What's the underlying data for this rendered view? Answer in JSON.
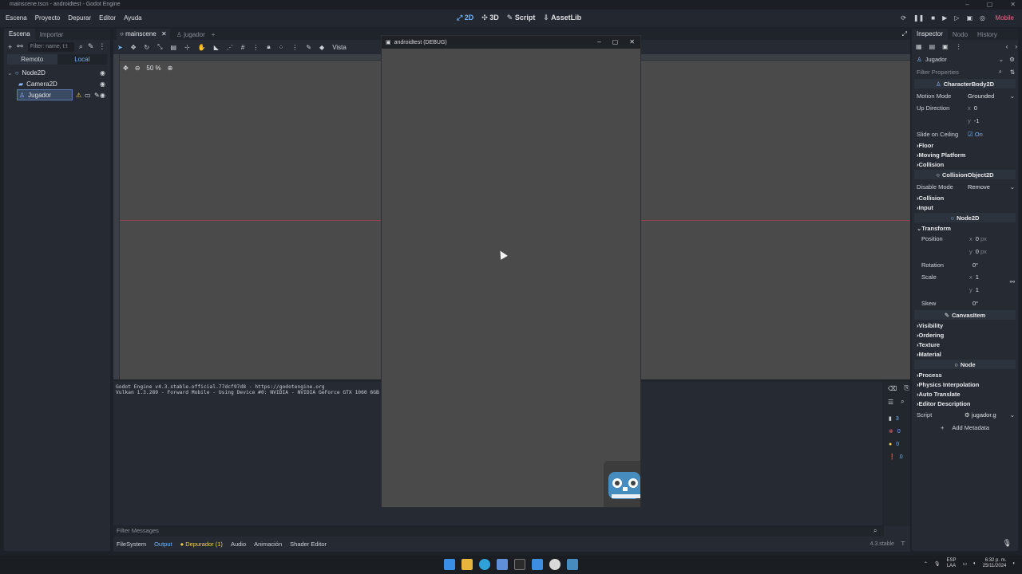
{
  "window": {
    "title": "mainscene.tscn - androidtest - Godot Engine",
    "controls": [
      "–",
      "▢",
      "✕"
    ]
  },
  "menu": {
    "items": [
      "Escena",
      "Proyecto",
      "Depurar",
      "Editor",
      "Ayuda"
    ]
  },
  "modes": {
    "d2": "2D",
    "d3": "3D",
    "script": "Script",
    "assetlib": "AssetLib"
  },
  "renderer": "Mobile",
  "scene_dock": {
    "tabs": [
      "Escena",
      "Importar"
    ],
    "filter_placeholder": "Filter: name, t:t",
    "remote": "Remoto",
    "local": "Local",
    "nodes": [
      {
        "label": "Node2D",
        "icon": "node2d-icon"
      },
      {
        "label": "Camera2D",
        "icon": "camera2d-icon"
      },
      {
        "label": "Jugador",
        "icon": "characterbody2d-icon"
      }
    ]
  },
  "center_tabs": [
    "mainscene",
    "jugador"
  ],
  "viewport": {
    "vista_label": "Vista",
    "zoom": "50 %"
  },
  "debug_window": {
    "title": "androidtest (DEBUG)"
  },
  "output": {
    "lines": [
      "Godot Engine v4.3.stable.official.77dcf97d8 - https://godotengine.org",
      "Vulkan 1.3.289 - Forward Mobile - Using Device #0: NVIDIA - NVIDIA GeForce GTX 1060 6GB"
    ],
    "counters": [
      "3",
      "0",
      "0",
      "0"
    ],
    "filter_placeholder": "Filter Messages"
  },
  "bottom_tabs": [
    "FileSystem",
    "Output",
    "Depurador (1)",
    "Audio",
    "Animación",
    "Shader Editor"
  ],
  "version": "4.3.stable",
  "inspector": {
    "tabs": [
      "Inspector",
      "Nodo",
      "History"
    ],
    "object": "Jugador",
    "filter_placeholder": "Filter Properties",
    "class1": "CharacterBody2D",
    "motion_mode": {
      "label": "Motion Mode",
      "value": "Grounded"
    },
    "up_direction": {
      "label": "Up Direction",
      "x": "0",
      "y": "-1"
    },
    "slide_on_ceiling": {
      "label": "Slide on Ceiling",
      "value": "On"
    },
    "groups1": [
      "Floor",
      "Moving Platform",
      "Collision"
    ],
    "class2": "CollisionObject2D",
    "disable_mode": {
      "label": "Disable Mode",
      "value": "Remove"
    },
    "groups2": [
      "Collision",
      "Input"
    ],
    "class3": "Node2D",
    "transform": "Transform",
    "position": {
      "label": "Position",
      "x": "0",
      "y": "0",
      "unit": "px"
    },
    "rotation": {
      "label": "Rotation",
      "value": "0"
    },
    "scale": {
      "label": "Scale",
      "x": "1",
      "y": "1"
    },
    "skew": {
      "label": "Skew",
      "value": "0"
    },
    "class4": "CanvasItem",
    "groups3": [
      "Visibility",
      "Ordering",
      "Texture",
      "Material"
    ],
    "class5": "Node",
    "groups4": [
      "Process",
      "Physics Interpolation",
      "Auto Translate",
      "Editor Description"
    ],
    "script": {
      "label": "Script",
      "value": "jugador.g"
    },
    "add_metadata": "Add Metadata"
  },
  "taskbar": {
    "lang": "ESP",
    "lang2": "LAA",
    "time": "6:32 p. m.",
    "date": "25/11/2024"
  }
}
